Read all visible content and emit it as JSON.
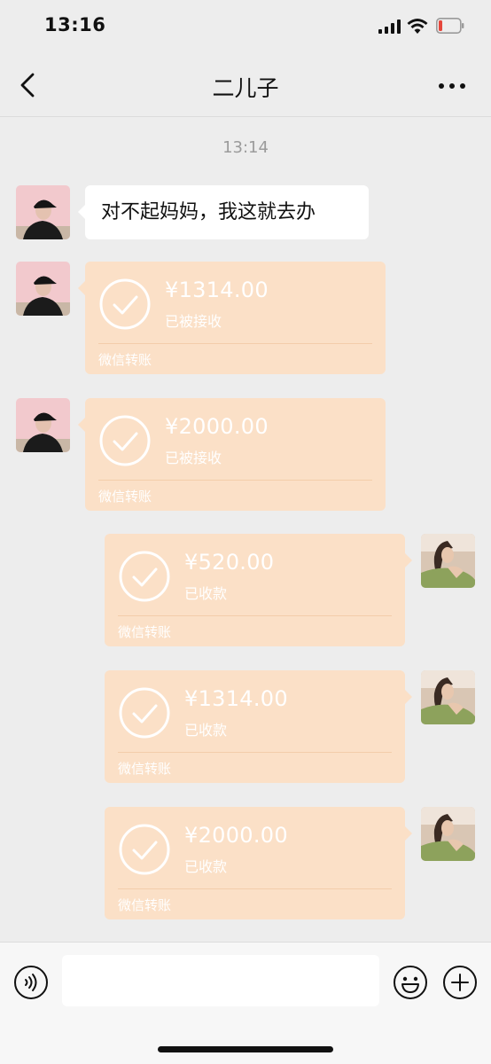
{
  "status_bar": {
    "time": "13:16"
  },
  "header": {
    "title": "二儿子"
  },
  "chat": {
    "timestamp": "13:14",
    "text_message": "对不起妈妈，我这就去办",
    "transfers": [
      {
        "amount": "¥1314.00",
        "status": "已被接收",
        "footer": "微信转账"
      },
      {
        "amount": "¥2000.00",
        "status": "已被接收",
        "footer": "微信转账"
      },
      {
        "amount": "¥520.00",
        "status": "已收款",
        "footer": "微信转账"
      },
      {
        "amount": "¥1314.00",
        "status": "已收款",
        "footer": "微信转账"
      },
      {
        "amount": "¥2000.00",
        "status": "已收款",
        "footer": "微信转账"
      }
    ]
  },
  "input_bar": {
    "value": "",
    "placeholder": ""
  },
  "icons": [
    "back-icon",
    "more-icon",
    "signal-icon",
    "wifi-icon",
    "battery-icon",
    "check-icon",
    "voice-icon",
    "emoji-icon",
    "plus-icon"
  ],
  "colors": {
    "transfer_card": "#fbe0c7",
    "background": "#ededed",
    "battery_low": "#e5473c"
  }
}
